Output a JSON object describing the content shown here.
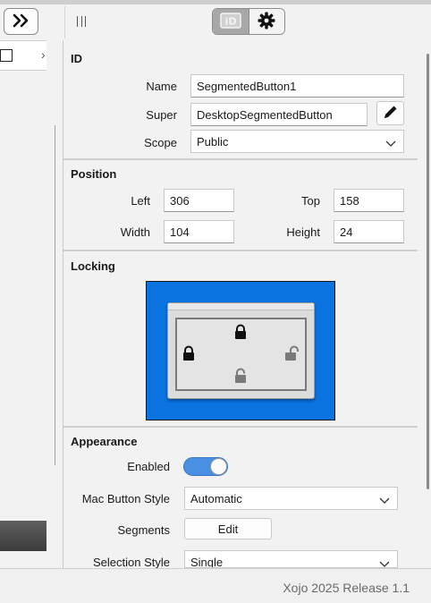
{
  "toolbar": {
    "expand_icon": "double-chevron-right-icon",
    "segments": [
      {
        "label": "ID",
        "icon": "id-icon",
        "selected": true
      },
      {
        "label": "",
        "icon": "gear-icon",
        "selected": false
      }
    ]
  },
  "left_panel": {
    "checkbox_checked": false,
    "row_glyph": "›"
  },
  "inspector": {
    "id_section": {
      "title": "ID",
      "name_label": "Name",
      "name_value": "SegmentedButton1",
      "super_label": "Super",
      "super_value": "DesktopSegmentedButton",
      "scope_label": "Scope",
      "scope_value": "Public"
    },
    "position_section": {
      "title": "Position",
      "left_label": "Left",
      "left_value": "306",
      "top_label": "Top",
      "top_value": "158",
      "width_label": "Width",
      "width_value": "104",
      "height_label": "Height",
      "height_value": "24"
    },
    "locking_section": {
      "title": "Locking",
      "top_locked": true,
      "left_locked": true,
      "right_locked": false,
      "bottom_locked": false,
      "accent_color": "#0a73e0"
    },
    "appearance_section": {
      "title": "Appearance",
      "enabled_label": "Enabled",
      "enabled": true,
      "mac_style_label": "Mac Button Style",
      "mac_style_value": "Automatic",
      "segments_label": "Segments",
      "segments_button": "Edit",
      "selection_style_label": "Selection Style",
      "selection_style_value": "Single"
    }
  },
  "status_bar": {
    "text": "Xojo 2025 Release 1.1"
  },
  "colors": {
    "toggle_on": "#4a90e2",
    "background": "#f2f2f2"
  }
}
